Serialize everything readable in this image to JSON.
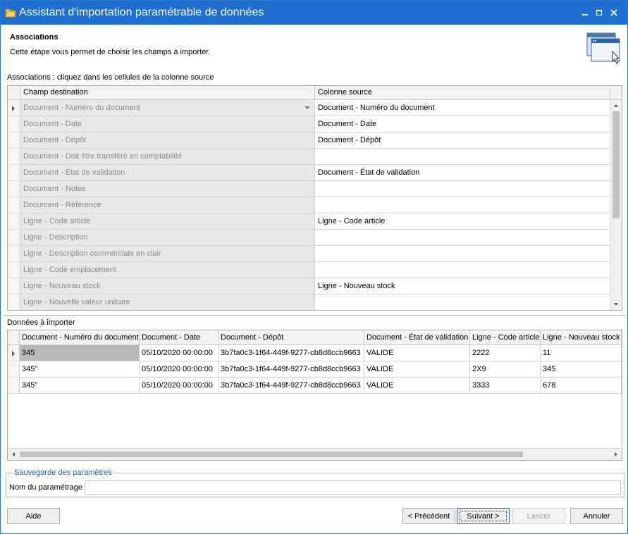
{
  "window": {
    "title": "Assistant d'importation paramétrable de données",
    "controls": [
      "minimize",
      "maximize",
      "close"
    ]
  },
  "header": {
    "title": "Associations",
    "subtitle": "Cette étape vous permet de choisir les champs à importer."
  },
  "associations": {
    "label": "Associations : cliquez dans les cellules de la colonne source",
    "columns": [
      "Champ destination",
      "Colonne source"
    ],
    "rows": [
      {
        "dest": "Document - Numéro du document",
        "source": "Document - Numéro du document"
      },
      {
        "dest": "Document - Date",
        "source": "Document - Date"
      },
      {
        "dest": "Document - Dépôt",
        "source": "Document - Dépôt"
      },
      {
        "dest": "Document - Doit être transféré en comptabilité",
        "source": ""
      },
      {
        "dest": "Document - État de validation",
        "source": "Document - État de validation"
      },
      {
        "dest": "Document - Notes",
        "source": ""
      },
      {
        "dest": "Document - Référence",
        "source": ""
      },
      {
        "dest": "Ligne - Code article",
        "source": "Ligne - Code article"
      },
      {
        "dest": "Ligne - Description",
        "source": ""
      },
      {
        "dest": "Ligne - Description commerciale en clair",
        "source": ""
      },
      {
        "dest": "Ligne - Code emplacement",
        "source": ""
      },
      {
        "dest": "Ligne - Nouveau stock",
        "source": "Ligne - Nouveau stock"
      },
      {
        "dest": "Ligne - Nouvelle valeur unitaire",
        "source": ""
      }
    ]
  },
  "data": {
    "label": "Données à importer",
    "columns": [
      "Document - Numéro du document",
      "Document - Date",
      "Document - Dépôt",
      "Document - État de validation",
      "Ligne - Code article",
      "Ligne - Nouveau stock"
    ],
    "rows": [
      [
        "345",
        "05/10/2020 00:00:00",
        "3b7fa0c3-1f64-449f-9277-cb8d8ccb9663",
        "VALIDE",
        "2222",
        "11"
      ],
      [
        "345\"",
        "05/10/2020 00:00:00",
        "3b7fa0c3-1f64-449f-9277-cb8d8ccb9663",
        "VALIDE",
        "2X9",
        "345"
      ],
      [
        "345\"",
        "05/10/2020 00:00:00",
        "3b7fa0c3-1f64-449f-9277-cb8d8ccb9663",
        "VALIDE",
        "3333",
        "678"
      ]
    ]
  },
  "save": {
    "legend": "Sauvegarde des paramètres",
    "name_label": "Nom du paramétrage",
    "name_value": ""
  },
  "buttons": {
    "help": "Aide",
    "previous": "< Précédent",
    "next": "Suivant >",
    "launch": "Lancer",
    "cancel": "Annuler"
  },
  "colors": {
    "titlebar": "#1f6fd0",
    "accent": "#1f5fa8"
  }
}
